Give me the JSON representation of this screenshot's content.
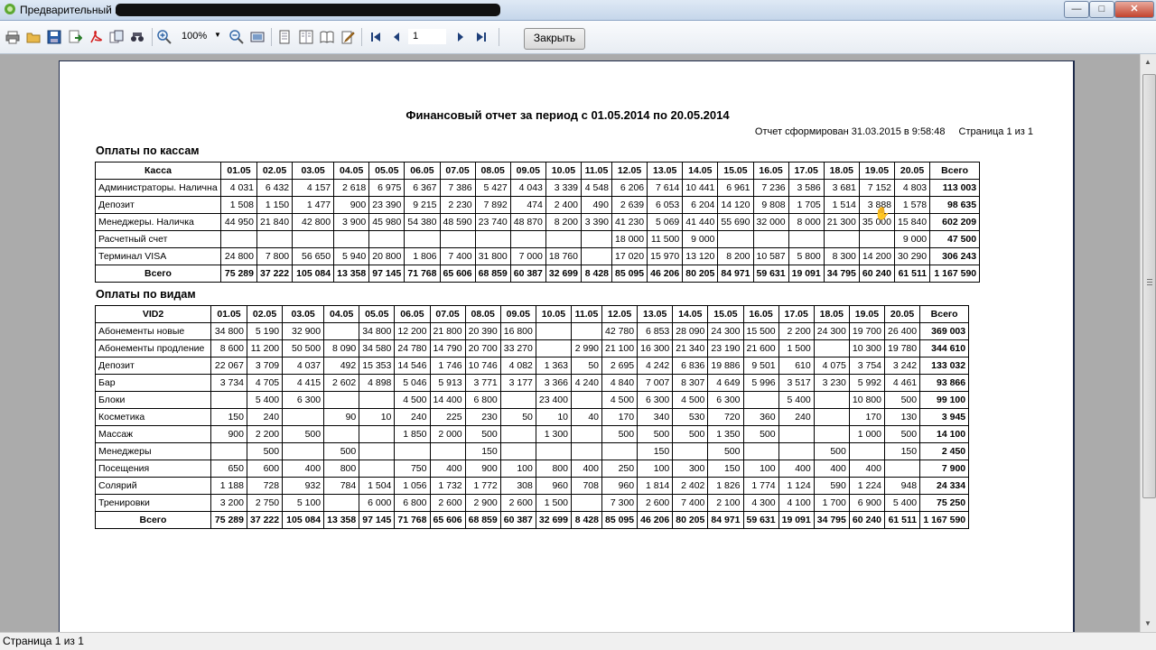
{
  "window": {
    "title": "Предварительный п",
    "minimize": "—",
    "maximize": "□",
    "close": "✕"
  },
  "toolbar": {
    "zoom": "100%",
    "page_number": "1",
    "close_label": "Закрыть",
    "icons": [
      "print-icon",
      "open-icon",
      "save-icon",
      "export-icon",
      "pdf-icon",
      "copy-icon",
      "find-icon",
      "zoom-in-icon",
      "zoom-out-icon",
      "fit-page-icon",
      "single-page-icon",
      "multi-page-icon",
      "book-icon",
      "edit-icon",
      "first-page-icon",
      "prev-page-icon",
      "next-page-icon",
      "last-page-icon"
    ]
  },
  "report": {
    "title": "Финансовый отчет за период с 01.05.2014 по 20.05.2014",
    "generated": "Отчет сформирован 31.03.2015 в 9:58:48",
    "page_info": "Страница 1 из 1",
    "section1": {
      "title": "Оплаты по кассам",
      "headers": [
        "Касса",
        "01.05",
        "02.05",
        "03.05",
        "04.05",
        "05.05",
        "06.05",
        "07.05",
        "08.05",
        "09.05",
        "10.05",
        "11.05",
        "12.05",
        "13.05",
        "14.05",
        "15.05",
        "16.05",
        "17.05",
        "18.05",
        "19.05",
        "20.05",
        "Всего"
      ],
      "rows": [
        [
          "Администраторы. Налична",
          "4 031",
          "6 432",
          "4 157",
          "2 618",
          "6 975",
          "6 367",
          "7 386",
          "5 427",
          "4 043",
          "3 339",
          "4 548",
          "6 206",
          "7 614",
          "10 441",
          "6 961",
          "7 236",
          "3 586",
          "3 681",
          "7 152",
          "4 803",
          "113 003"
        ],
        [
          "Депозит",
          "1 508",
          "1 150",
          "1 477",
          "900",
          "23 390",
          "9 215",
          "2 230",
          "7 892",
          "474",
          "2 400",
          "490",
          "2 639",
          "6 053",
          "6 204",
          "14 120",
          "9 808",
          "1 705",
          "1 514",
          "3 888",
          "1 578",
          "98 635"
        ],
        [
          "Менеджеры. Наличка",
          "44 950",
          "21 840",
          "42 800",
          "3 900",
          "45 980",
          "54 380",
          "48 590",
          "23 740",
          "48 870",
          "8 200",
          "3 390",
          "41 230",
          "5 069",
          "41 440",
          "55 690",
          "32 000",
          "8 000",
          "21 300",
          "35 000",
          "15 840",
          "602 209"
        ],
        [
          "Расчетный счет",
          "",
          "",
          "",
          "",
          "",
          "",
          "",
          "",
          "",
          "",
          "",
          "18 000",
          "11 500",
          "9 000",
          "",
          "",
          "",
          "",
          "",
          "9 000",
          "47 500"
        ],
        [
          "Терминал VISA",
          "24 800",
          "7 800",
          "56 650",
          "5 940",
          "20 800",
          "1 806",
          "7 400",
          "31 800",
          "7 000",
          "18 760",
          "",
          "17 020",
          "15 970",
          "13 120",
          "8 200",
          "10 587",
          "5 800",
          "8 300",
          "14 200",
          "30 290",
          "306 243"
        ]
      ],
      "total": [
        "Всего",
        "75 289",
        "37 222",
        "105 084",
        "13 358",
        "97 145",
        "71 768",
        "65 606",
        "68 859",
        "60 387",
        "32 699",
        "8 428",
        "85 095",
        "46 206",
        "80 205",
        "84 971",
        "59 631",
        "19 091",
        "34 795",
        "60 240",
        "61 511",
        "1 167 590"
      ]
    },
    "section2": {
      "title": "Оплаты по видам",
      "headers": [
        "VID2",
        "01.05",
        "02.05",
        "03.05",
        "04.05",
        "05.05",
        "06.05",
        "07.05",
        "08.05",
        "09.05",
        "10.05",
        "11.05",
        "12.05",
        "13.05",
        "14.05",
        "15.05",
        "16.05",
        "17.05",
        "18.05",
        "19.05",
        "20.05",
        "Всего"
      ],
      "rows": [
        [
          "Абонементы новые",
          "34 800",
          "5 190",
          "32 900",
          "",
          "34 800",
          "12 200",
          "21 800",
          "20 390",
          "16 800",
          "",
          "",
          "42 780",
          "6 853",
          "28 090",
          "24 300",
          "15 500",
          "2 200",
          "24 300",
          "19 700",
          "26 400",
          "369 003"
        ],
        [
          "Абонементы продление",
          "8 600",
          "11 200",
          "50 500",
          "8 090",
          "34 580",
          "24 780",
          "14 790",
          "20 700",
          "33 270",
          "",
          "2 990",
          "21 100",
          "16 300",
          "21 340",
          "23 190",
          "21 600",
          "1 500",
          "",
          "10 300",
          "19 780",
          "344 610"
        ],
        [
          "Депозит",
          "22 067",
          "3 709",
          "4 037",
          "492",
          "15 353",
          "14 546",
          "1 746",
          "10 746",
          "4 082",
          "1 363",
          "50",
          "2 695",
          "4 242",
          "6 836",
          "19 886",
          "9 501",
          "610",
          "4 075",
          "3 754",
          "3 242",
          "133 032"
        ],
        [
          "Бар",
          "3 734",
          "4 705",
          "4 415",
          "2 602",
          "4 898",
          "5 046",
          "5 913",
          "3 771",
          "3 177",
          "3 366",
          "4 240",
          "4 840",
          "7 007",
          "8 307",
          "4 649",
          "5 996",
          "3 517",
          "3 230",
          "5 992",
          "4 461",
          "93 866"
        ],
        [
          "Блоки",
          "",
          "5 400",
          "6 300",
          "",
          "",
          "4 500",
          "14 400",
          "6 800",
          "",
          "23 400",
          "",
          "4 500",
          "6 300",
          "4 500",
          "6 300",
          "",
          "5 400",
          "",
          "10 800",
          "500",
          "99 100"
        ],
        [
          "Косметика",
          "150",
          "240",
          "",
          "90",
          "10",
          "240",
          "225",
          "230",
          "50",
          "10",
          "40",
          "170",
          "340",
          "530",
          "720",
          "360",
          "240",
          "",
          "170",
          "130",
          "3 945"
        ],
        [
          "Массаж",
          "900",
          "2 200",
          "500",
          "",
          "",
          "1 850",
          "2 000",
          "500",
          "",
          "1 300",
          "",
          "500",
          "500",
          "500",
          "1 350",
          "500",
          "",
          "",
          "1 000",
          "500",
          "14 100"
        ],
        [
          "Менеджеры",
          "",
          "500",
          "",
          "500",
          "",
          "",
          "",
          "150",
          "",
          "",
          "",
          "",
          "150",
          "",
          "500",
          "",
          "",
          "500",
          "",
          "150",
          "2 450"
        ],
        [
          "Посещения",
          "650",
          "600",
          "400",
          "800",
          "",
          "750",
          "400",
          "900",
          "100",
          "800",
          "400",
          "250",
          "100",
          "300",
          "150",
          "100",
          "400",
          "400",
          "400",
          "",
          "7 900"
        ],
        [
          "Солярий",
          "1 188",
          "728",
          "932",
          "784",
          "1 504",
          "1 056",
          "1 732",
          "1 772",
          "308",
          "960",
          "708",
          "960",
          "1 814",
          "2 402",
          "1 826",
          "1 774",
          "1 124",
          "590",
          "1 224",
          "948",
          "24 334"
        ],
        [
          "Тренировки",
          "3 200",
          "2 750",
          "5 100",
          "",
          "6 000",
          "6 800",
          "2 600",
          "2 900",
          "2 600",
          "1 500",
          "",
          "7 300",
          "2 600",
          "7 400",
          "2 100",
          "4 300",
          "4 100",
          "1 700",
          "6 900",
          "5 400",
          "75 250"
        ]
      ],
      "total": [
        "Всего",
        "75 289",
        "37 222",
        "105 084",
        "13 358",
        "97 145",
        "71 768",
        "65 606",
        "68 859",
        "60 387",
        "32 699",
        "8 428",
        "85 095",
        "46 206",
        "80 205",
        "84 971",
        "59 631",
        "19 091",
        "34 795",
        "60 240",
        "61 511",
        "1 167 590"
      ]
    }
  },
  "status": {
    "text": "Страница 1 из 1"
  }
}
